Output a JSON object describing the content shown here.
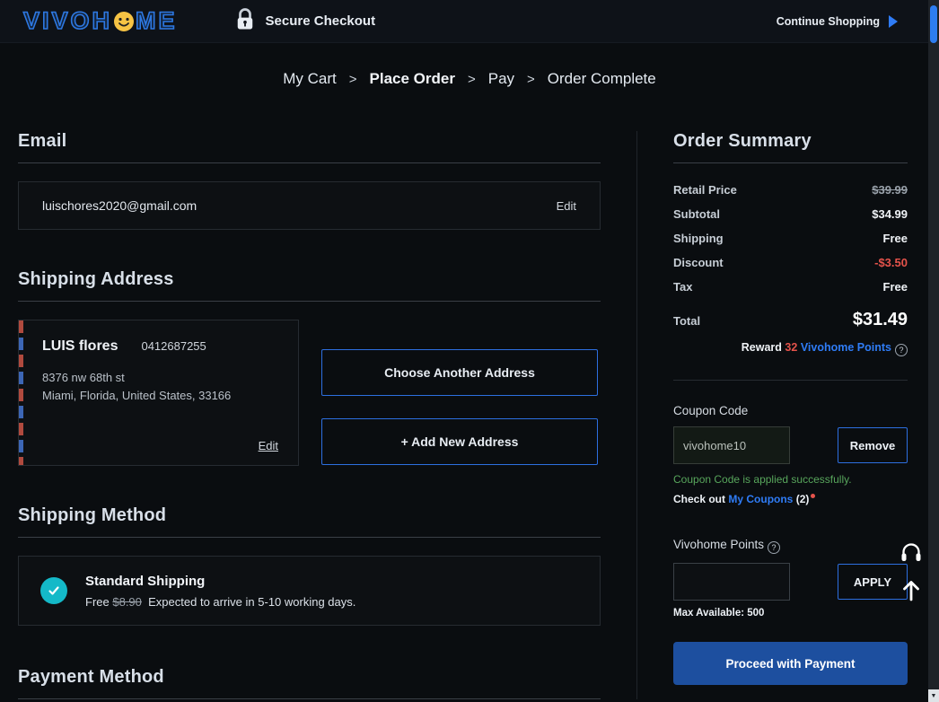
{
  "header": {
    "logo_part1": "VIVOH",
    "logo_part2": "ME",
    "secure_checkout": "Secure Checkout",
    "continue_shopping": "Continue Shopping"
  },
  "breadcrumb": {
    "separator": ">",
    "items": [
      {
        "label": "My Cart"
      },
      {
        "label": "Place Order"
      },
      {
        "label": "Pay"
      },
      {
        "label": "Order Complete"
      }
    ]
  },
  "email": {
    "title": "Email",
    "value": "luischores2020@gmail.com",
    "edit": "Edit"
  },
  "address": {
    "title": "Shipping Address",
    "name": "LUIS flores",
    "phone": "0412687255",
    "line1": "8376 nw 68th st",
    "line2": "Miami, Florida, United States, 33166",
    "edit": "Edit",
    "choose_button": "Choose Another Address",
    "add_button": "+ Add New Address"
  },
  "shipping": {
    "title": "Shipping Method",
    "name": "Standard Shipping",
    "price": "Free",
    "original_price": "$8.90",
    "eta": "Expected to arrive in 5-10 working days."
  },
  "payment": {
    "title": "Payment Method"
  },
  "summary": {
    "title": "Order Summary",
    "rows": [
      {
        "label": "Retail Price",
        "value": "$39.99"
      },
      {
        "label": "Subtotal",
        "value": "$34.99"
      },
      {
        "label": "Shipping",
        "value": "Free"
      },
      {
        "label": "Discount",
        "value": "-$3.50"
      },
      {
        "label": "Tax",
        "value": "Free"
      }
    ],
    "total_label": "Total",
    "total_value": "$31.49",
    "reward_prefix": "Reward",
    "reward_points": "32",
    "reward_suffix": "Vivohome Points"
  },
  "coupon": {
    "label": "Coupon Code",
    "value": "vivohome10",
    "remove": "Remove",
    "success": "Coupon Code is applied successfully.",
    "checkout_prefix": "Check out",
    "link": "My Coupons",
    "count": "(2)"
  },
  "points": {
    "label": "Vivohome Points",
    "apply": "APPLY",
    "max": "Max Available: 500"
  },
  "proceed": {
    "label": "Proceed with Payment"
  },
  "colors": {
    "accent": "#2f7cf6",
    "success": "#58a65c",
    "danger": "#e5534b",
    "teal": "#14b9c8",
    "proceed_bg": "#1d4f9f"
  }
}
